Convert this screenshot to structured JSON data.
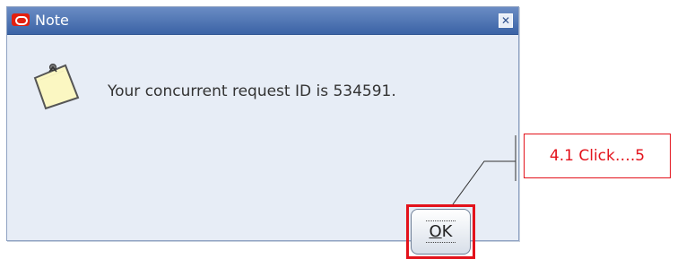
{
  "dialog": {
    "title": "Note",
    "close_icon": "close-icon",
    "app_icon": "oracle-logo-icon",
    "message_icon": "note-icon",
    "message": "Your concurrent request ID is 534591.",
    "ok_label": "OK",
    "ok_accelerator": "O",
    "ok_rest": "K"
  },
  "annotation": {
    "callout_text": "4.1 Click….5",
    "color": "#e3121b"
  }
}
